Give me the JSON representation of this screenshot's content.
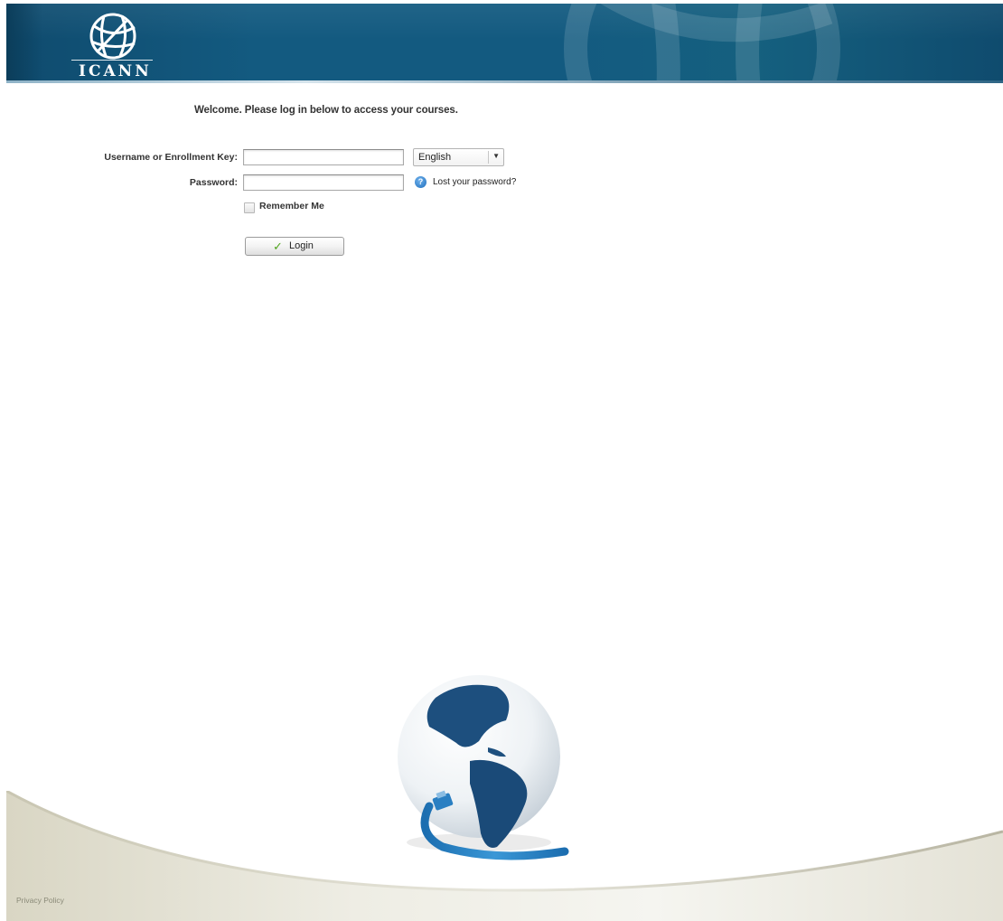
{
  "header": {
    "logo_text": "ICANN"
  },
  "login": {
    "welcome": "Welcome. Please log in below to access your courses.",
    "username_label": "Username or Enrollment Key:",
    "username_value": "",
    "password_label": "Password:",
    "password_value": "",
    "language_selected": "English",
    "lost_password": "Lost your password?",
    "remember_label": "Remember Me",
    "remember_checked": false,
    "login_button": "Login"
  },
  "footer": {
    "privacy_policy": "Privacy Policy"
  },
  "colors": {
    "header_bg": "#135a80",
    "accent_green": "#52a620",
    "help_blue": "#1f6fbd",
    "cable_blue": "#2f86c8"
  },
  "icons": {
    "logo": "icann-globe-logo",
    "help": "help-icon",
    "check": "checkmark-icon",
    "dropdown": "chevron-down-icon"
  }
}
